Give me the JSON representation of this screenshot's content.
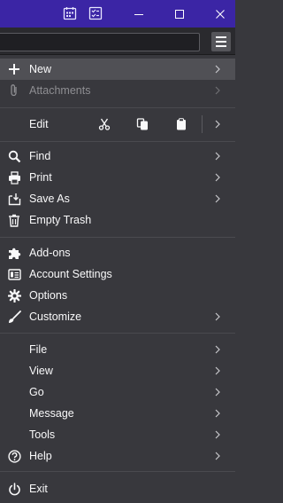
{
  "titlebar": {
    "icons": [
      "calendar-icon",
      "tasks-icon"
    ],
    "controls": [
      "minimize",
      "maximize",
      "close"
    ]
  },
  "toolbar": {
    "search_placeholder": "",
    "menu_button_icon": "hamburger-icon"
  },
  "menu": {
    "new": "New",
    "attachments": "Attachments",
    "edit": "Edit",
    "edit_actions": [
      "cut-icon",
      "copy-icon",
      "paste-icon"
    ],
    "find": "Find",
    "print": "Print",
    "save_as": "Save As",
    "empty_trash": "Empty Trash",
    "addons": "Add-ons",
    "account_settings": "Account Settings",
    "options": "Options",
    "customize": "Customize",
    "file": "File",
    "view": "View",
    "go": "Go",
    "message": "Message",
    "tools": "Tools",
    "help": "Help",
    "exit": "Exit"
  },
  "colors": {
    "titlebar": "#3b25a5",
    "menu_bg": "#38383d",
    "highlight": "#505055",
    "text": "#f9f9fa",
    "disabled_text": "#8e8e92"
  }
}
